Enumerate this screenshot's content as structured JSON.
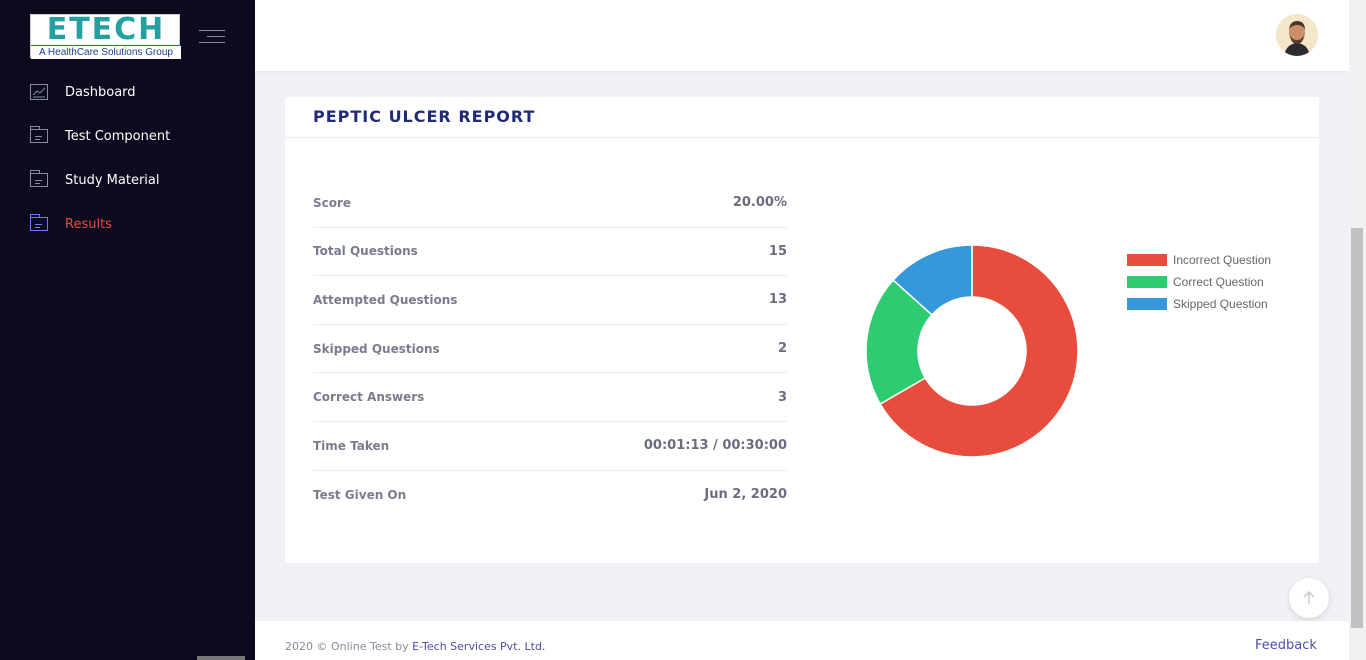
{
  "brand": {
    "logo_text": "ETECH",
    "logo_subtitle": "A HealthCare Solutions Group",
    "logo_color": "#25a0a0"
  },
  "sidebar": {
    "items": [
      {
        "label": "Dashboard",
        "icon": "chart-icon",
        "active": false
      },
      {
        "label": "Test Component",
        "icon": "folder-icon",
        "active": false
      },
      {
        "label": "Study Material",
        "icon": "folder-icon",
        "active": false
      },
      {
        "label": "Results",
        "icon": "folder-icon",
        "active": true
      }
    ]
  },
  "header": {
    "avatar_icon": "user-avatar"
  },
  "report": {
    "title": "PEPTIC ULCER REPORT",
    "rows": [
      {
        "label": "Score",
        "value": "20.00%"
      },
      {
        "label": "Total Questions",
        "value": "15"
      },
      {
        "label": "Attempted Questions",
        "value": "13"
      },
      {
        "label": "Skipped Questions",
        "value": "2"
      },
      {
        "label": "Correct Answers",
        "value": "3"
      },
      {
        "label": "Time Taken",
        "value": "00:01:13 / 00:30:00"
      },
      {
        "label": "Test Given On",
        "value": "Jun 2, 2020"
      }
    ]
  },
  "chart_data": {
    "type": "pie",
    "donut": true,
    "categories": [
      "Incorrect Question",
      "Correct Question",
      "Skipped Question"
    ],
    "values": [
      10,
      3,
      2
    ],
    "colors": [
      "#e84c3d",
      "#2ecc71",
      "#3498db"
    ],
    "legend_position": "right"
  },
  "footer": {
    "copyright": "2020 © Online Test by ",
    "company_link": "E-Tech Services Pvt. Ltd.",
    "feedback": "Feedback"
  },
  "colors": {
    "sidebar_bg": "#0b0a1f",
    "active_nav": "#e84c3d",
    "title": "#1f2a78",
    "link": "#4b4ea8"
  }
}
